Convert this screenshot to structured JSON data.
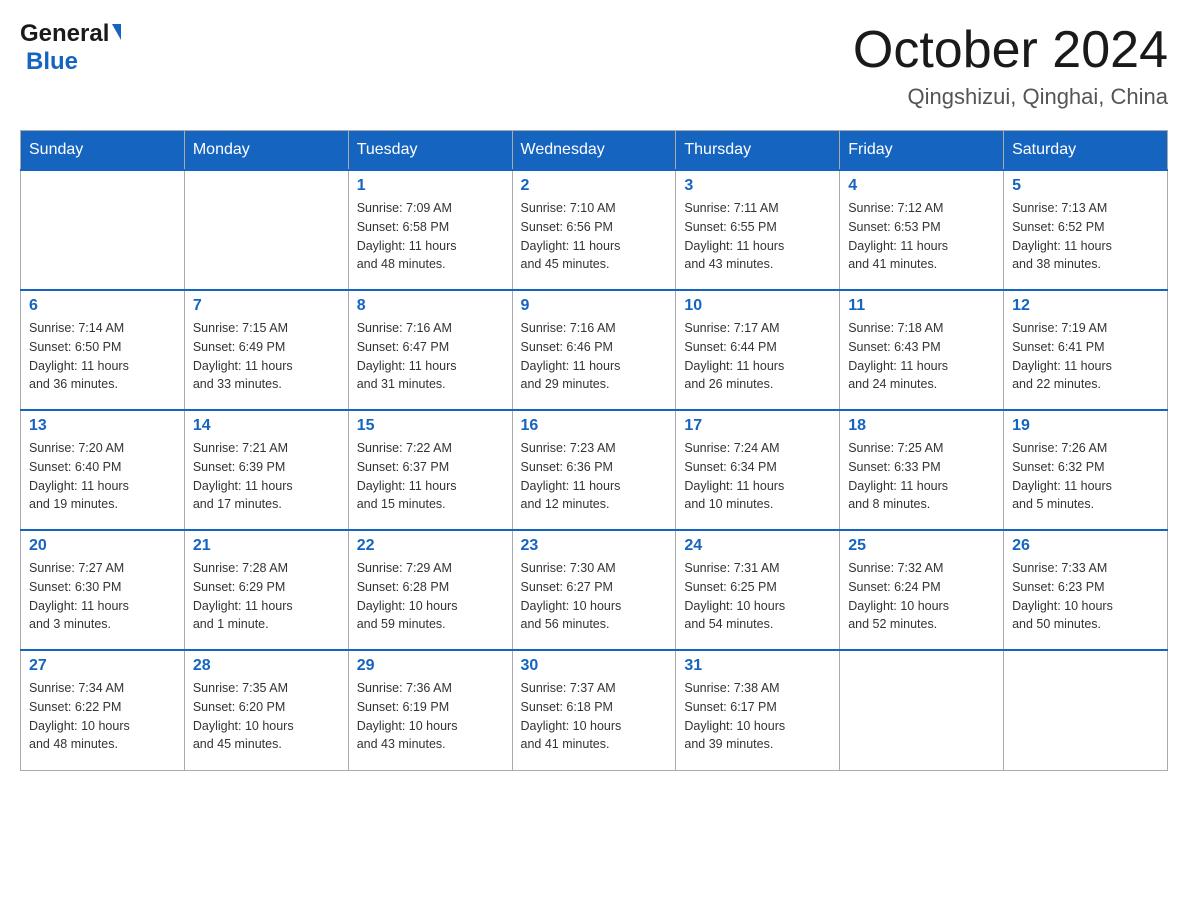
{
  "header": {
    "logo_general": "General",
    "logo_blue": "Blue",
    "title": "October 2024",
    "subtitle": "Qingshizui, Qinghai, China"
  },
  "days_of_week": [
    "Sunday",
    "Monday",
    "Tuesday",
    "Wednesday",
    "Thursday",
    "Friday",
    "Saturday"
  ],
  "weeks": [
    {
      "days": [
        {
          "number": "",
          "info": ""
        },
        {
          "number": "",
          "info": ""
        },
        {
          "number": "1",
          "info": "Sunrise: 7:09 AM\nSunset: 6:58 PM\nDaylight: 11 hours\nand 48 minutes."
        },
        {
          "number": "2",
          "info": "Sunrise: 7:10 AM\nSunset: 6:56 PM\nDaylight: 11 hours\nand 45 minutes."
        },
        {
          "number": "3",
          "info": "Sunrise: 7:11 AM\nSunset: 6:55 PM\nDaylight: 11 hours\nand 43 minutes."
        },
        {
          "number": "4",
          "info": "Sunrise: 7:12 AM\nSunset: 6:53 PM\nDaylight: 11 hours\nand 41 minutes."
        },
        {
          "number": "5",
          "info": "Sunrise: 7:13 AM\nSunset: 6:52 PM\nDaylight: 11 hours\nand 38 minutes."
        }
      ]
    },
    {
      "days": [
        {
          "number": "6",
          "info": "Sunrise: 7:14 AM\nSunset: 6:50 PM\nDaylight: 11 hours\nand 36 minutes."
        },
        {
          "number": "7",
          "info": "Sunrise: 7:15 AM\nSunset: 6:49 PM\nDaylight: 11 hours\nand 33 minutes."
        },
        {
          "number": "8",
          "info": "Sunrise: 7:16 AM\nSunset: 6:47 PM\nDaylight: 11 hours\nand 31 minutes."
        },
        {
          "number": "9",
          "info": "Sunrise: 7:16 AM\nSunset: 6:46 PM\nDaylight: 11 hours\nand 29 minutes."
        },
        {
          "number": "10",
          "info": "Sunrise: 7:17 AM\nSunset: 6:44 PM\nDaylight: 11 hours\nand 26 minutes."
        },
        {
          "number": "11",
          "info": "Sunrise: 7:18 AM\nSunset: 6:43 PM\nDaylight: 11 hours\nand 24 minutes."
        },
        {
          "number": "12",
          "info": "Sunrise: 7:19 AM\nSunset: 6:41 PM\nDaylight: 11 hours\nand 22 minutes."
        }
      ]
    },
    {
      "days": [
        {
          "number": "13",
          "info": "Sunrise: 7:20 AM\nSunset: 6:40 PM\nDaylight: 11 hours\nand 19 minutes."
        },
        {
          "number": "14",
          "info": "Sunrise: 7:21 AM\nSunset: 6:39 PM\nDaylight: 11 hours\nand 17 minutes."
        },
        {
          "number": "15",
          "info": "Sunrise: 7:22 AM\nSunset: 6:37 PM\nDaylight: 11 hours\nand 15 minutes."
        },
        {
          "number": "16",
          "info": "Sunrise: 7:23 AM\nSunset: 6:36 PM\nDaylight: 11 hours\nand 12 minutes."
        },
        {
          "number": "17",
          "info": "Sunrise: 7:24 AM\nSunset: 6:34 PM\nDaylight: 11 hours\nand 10 minutes."
        },
        {
          "number": "18",
          "info": "Sunrise: 7:25 AM\nSunset: 6:33 PM\nDaylight: 11 hours\nand 8 minutes."
        },
        {
          "number": "19",
          "info": "Sunrise: 7:26 AM\nSunset: 6:32 PM\nDaylight: 11 hours\nand 5 minutes."
        }
      ]
    },
    {
      "days": [
        {
          "number": "20",
          "info": "Sunrise: 7:27 AM\nSunset: 6:30 PM\nDaylight: 11 hours\nand 3 minutes."
        },
        {
          "number": "21",
          "info": "Sunrise: 7:28 AM\nSunset: 6:29 PM\nDaylight: 11 hours\nand 1 minute."
        },
        {
          "number": "22",
          "info": "Sunrise: 7:29 AM\nSunset: 6:28 PM\nDaylight: 10 hours\nand 59 minutes."
        },
        {
          "number": "23",
          "info": "Sunrise: 7:30 AM\nSunset: 6:27 PM\nDaylight: 10 hours\nand 56 minutes."
        },
        {
          "number": "24",
          "info": "Sunrise: 7:31 AM\nSunset: 6:25 PM\nDaylight: 10 hours\nand 54 minutes."
        },
        {
          "number": "25",
          "info": "Sunrise: 7:32 AM\nSunset: 6:24 PM\nDaylight: 10 hours\nand 52 minutes."
        },
        {
          "number": "26",
          "info": "Sunrise: 7:33 AM\nSunset: 6:23 PM\nDaylight: 10 hours\nand 50 minutes."
        }
      ]
    },
    {
      "days": [
        {
          "number": "27",
          "info": "Sunrise: 7:34 AM\nSunset: 6:22 PM\nDaylight: 10 hours\nand 48 minutes."
        },
        {
          "number": "28",
          "info": "Sunrise: 7:35 AM\nSunset: 6:20 PM\nDaylight: 10 hours\nand 45 minutes."
        },
        {
          "number": "29",
          "info": "Sunrise: 7:36 AM\nSunset: 6:19 PM\nDaylight: 10 hours\nand 43 minutes."
        },
        {
          "number": "30",
          "info": "Sunrise: 7:37 AM\nSunset: 6:18 PM\nDaylight: 10 hours\nand 41 minutes."
        },
        {
          "number": "31",
          "info": "Sunrise: 7:38 AM\nSunset: 6:17 PM\nDaylight: 10 hours\nand 39 minutes."
        },
        {
          "number": "",
          "info": ""
        },
        {
          "number": "",
          "info": ""
        }
      ]
    }
  ]
}
